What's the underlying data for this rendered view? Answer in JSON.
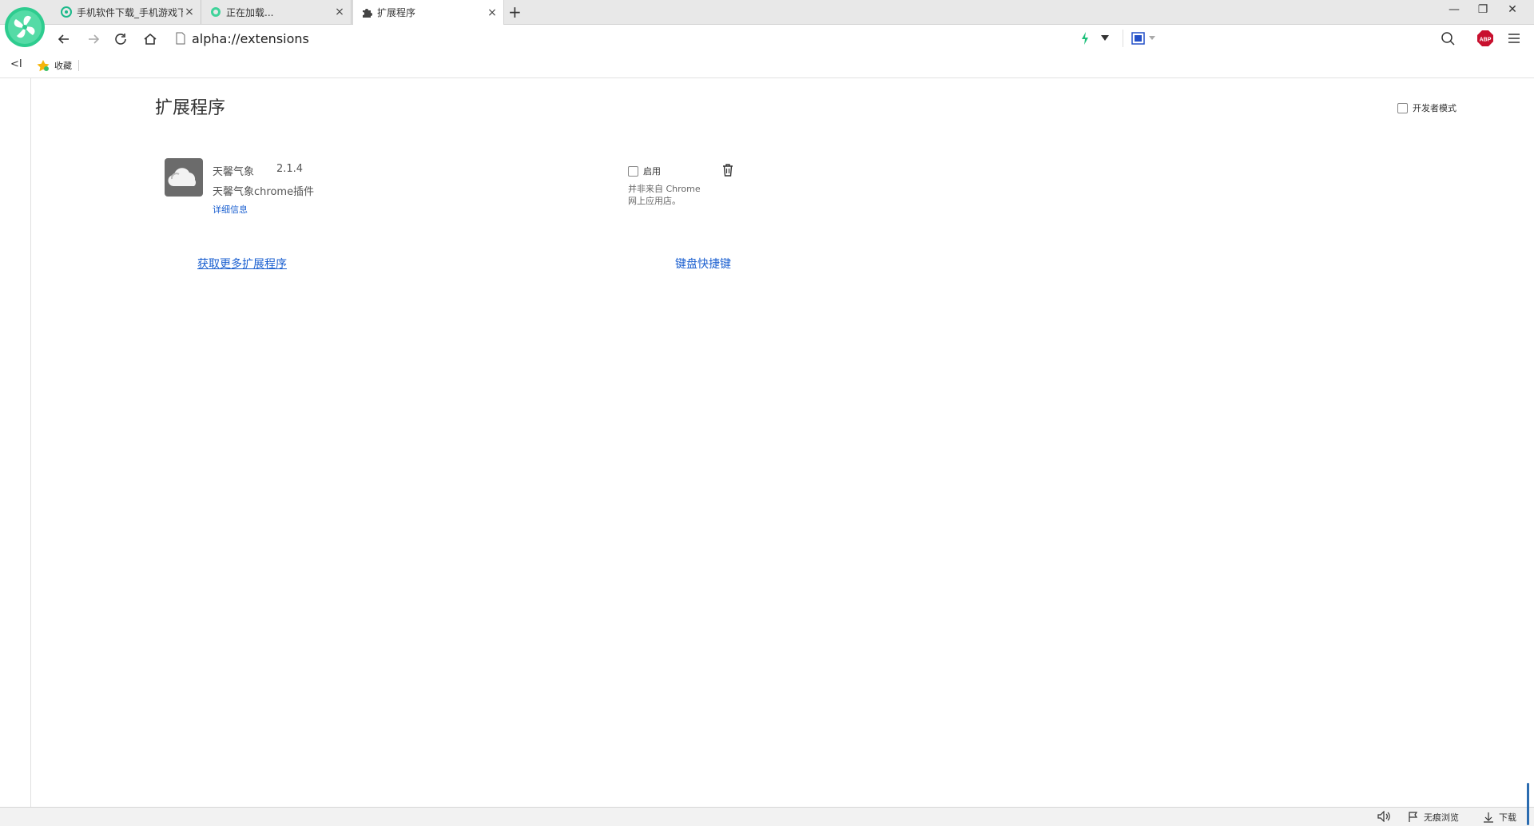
{
  "browser": {
    "tabs": [
      {
        "title": "手机软件下载_手机游戏下",
        "icon": "site-favicon-icon"
      },
      {
        "title": "正在加载...",
        "icon": "loading-favicon-icon"
      },
      {
        "title": "扩展程序",
        "icon": "puzzle-icon",
        "active": true
      }
    ],
    "new_tab_label": "+",
    "address": "alpha://extensions",
    "bookmarks": {
      "collapse_label": "<I",
      "favorites_label": "收藏"
    },
    "toolbar_right": {
      "adblock_label": "ABP"
    },
    "status": {
      "incognito_label": "无痕浏览",
      "download_label": "下载"
    }
  },
  "page": {
    "title": "扩展程序",
    "developer_mode_label": "开发者模式",
    "extension": {
      "name": "天馨气象",
      "version": "2.1.4",
      "description": "天馨气象chrome插件",
      "details_label": "详细信息",
      "enable_label": "启用",
      "warning_line1": "并非来自 Chrome",
      "warning_line2": "网上应用店。"
    },
    "get_more_label": "获取更多扩展程序",
    "keyboard_shortcuts_label": "键盘快捷键"
  },
  "colors": {
    "accent_link": "#1a5fd0",
    "logo_green": "#2ecc8f",
    "adblock_red": "#c8102e"
  }
}
